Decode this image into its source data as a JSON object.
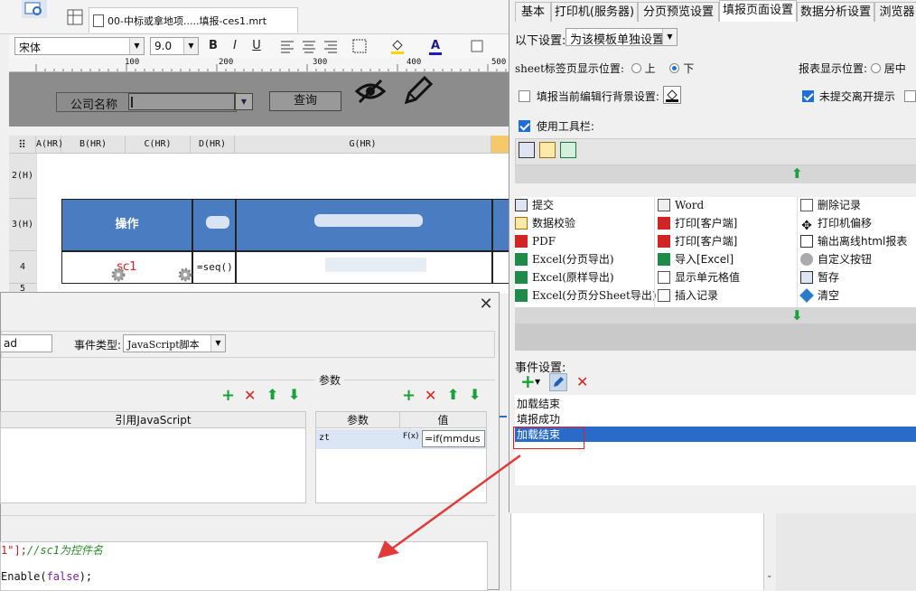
{
  "editor": {
    "file_tab": "00-中标或拿地项.....填报-ces1.mrt",
    "font_name": "宋体",
    "font_size": "9.0",
    "ruler_marks": [
      "100",
      "200",
      "300",
      "400",
      "500"
    ],
    "design": {
      "company_label": "公司名称",
      "query_button": "查询"
    },
    "columns": [
      "A(HR)",
      "B(HR)",
      "C(HR)",
      "D(HR)",
      "G(HR)"
    ],
    "rows": [
      "2(H)",
      "3(H)",
      "4",
      "5"
    ],
    "header_cell": "操作",
    "sc1_cell": "sc1",
    "seq_cell": "=seq()"
  },
  "dialog": {
    "name_value": "ad",
    "event_type_label": "事件类型:",
    "event_type_value": "JavaScript脚本",
    "params_group": "参数",
    "ref_js_header": "引用JavaScript",
    "param_col": "参数",
    "value_col": "值",
    "param_name": "zt",
    "fx_label": "F(x)",
    "param_value": "=if(mmdus",
    "code_line1_prefix": "1\"];",
    "code_line1_comment": "//sc1为控件名",
    "code_line2_prefix": "Enable(",
    "code_line2_keyword": "false",
    "code_line2_suffix": ");"
  },
  "panel": {
    "tabs": [
      "基本",
      "打印机(服务器)",
      "分页预览设置",
      "填报页面设置",
      "数据分析设置",
      "浏览器"
    ],
    "scope_label": "以下设置:",
    "scope_value": "为该模板单独设置",
    "sheet_pos_label": "sheet标签页显示位置:",
    "sheet_pos_up": "上",
    "sheet_pos_down": "下",
    "report_pos_label": "报表显示位置:",
    "report_pos_center": "居中",
    "fill_bg_label": "填报当前编辑行背景设置:",
    "unsubmit_label": "未提交离开提示",
    "use_toolbar_label": "使用工具栏:",
    "tools": [
      [
        "提交",
        "Word",
        "删除记录"
      ],
      [
        "数据校验",
        "打印[客户端]",
        "打印机偏移"
      ],
      [
        "PDF",
        "打印[客户端]",
        "输出离线html报表"
      ],
      [
        "Excel(分页导出)",
        "导入[Excel]",
        "自定义按钮"
      ],
      [
        "Excel(原样导出)",
        "显示单元格值",
        "暂存"
      ],
      [
        "Excel(分页分Sheet导出)",
        "插入记录",
        "清空"
      ]
    ],
    "event_settings_label": "事件设置:",
    "events": [
      "加载结束",
      "填报成功",
      "加载结束"
    ],
    "selected_event_index": 2
  },
  "colors": {
    "accent": "#2a6bc9",
    "header_cell": "#4a7cc2",
    "arrow": "#e23a3a",
    "green": "#18a33a"
  }
}
